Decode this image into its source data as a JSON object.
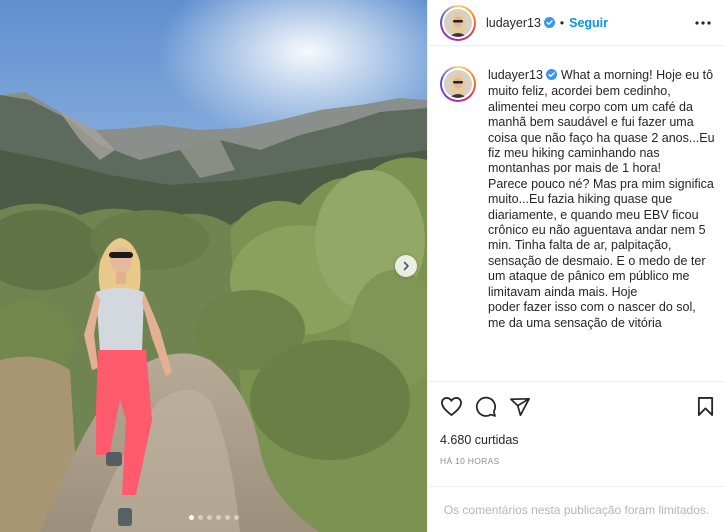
{
  "post": {
    "username": "ludayer13",
    "follow_label": "Seguir",
    "separator": "•",
    "caption": "What a morning! Hoje eu tô muito feliz, acordei bem cedinho, alimentei meu corpo com um café da manhã bem saudável e fui fazer uma coisa que não faço ha quase 2 anos...Eu fiz meu hiking caminhando nas montanhas por mais de 1 hora!\nParece pouco né? Mas pra mim significa muito...Eu fazia hiking quase que diariamente, e quando meu EBV ficou crônico eu não aguentava andar nem 5 min. Tinha falta de ar, palpitação, sensação de desmaio. E o medo de ter um ataque de pânico em público me limitavam ainda mais. Hoje\npoder fazer isso com o nascer do sol, me da uma sensação de vitória",
    "likes": "4.680 curtidas",
    "time": "HÁ 10 HORAS",
    "comments_limited": "Os comentários nesta publicação foram limitados."
  },
  "carousel": {
    "total": 6,
    "active_index": 0
  },
  "icons": {
    "verified": "verified-badge-icon",
    "more": "more-options-icon",
    "like": "heart-icon",
    "comment": "comment-icon",
    "share": "share-icon",
    "save": "bookmark-icon",
    "next": "chevron-right-icon"
  },
  "colors": {
    "follow": "#0095f6",
    "verified": "#3897f0",
    "text": "#262626",
    "muted": "#8e8e8e"
  }
}
